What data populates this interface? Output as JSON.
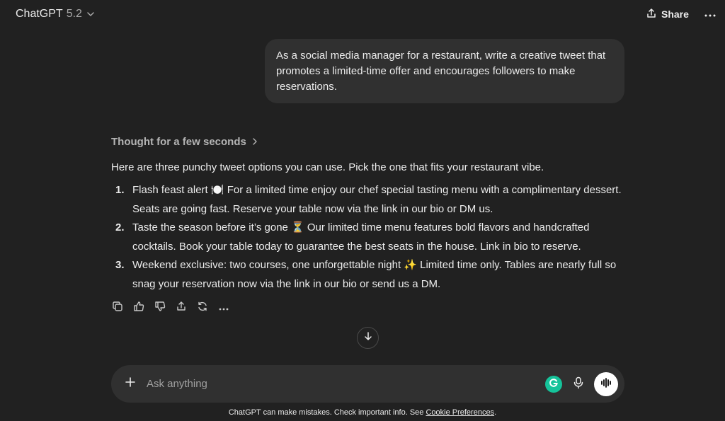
{
  "header": {
    "model_name": "ChatGPT",
    "model_version": "5.2",
    "share_label": "Share"
  },
  "conversation": {
    "user_message": "As a social media manager for a restaurant, write a creative tweet that promotes a limited-time offer and encourages followers to make reservations.",
    "thought_label": "Thought for a few seconds",
    "intro": "Here are three punchy tweet options you can use. Pick the one that fits your restaurant vibe.",
    "options": [
      {
        "number": "1.",
        "text": "Flash feast alert 🍽️ For a limited time enjoy our chef special tasting menu with a complimentary dessert. Seats are going fast. Reserve your table now via the link in our bio or DM us."
      },
      {
        "number": "2.",
        "text": "Taste the season before it’s gone ⏳ Our limited time menu features bold flavors and handcrafted cocktails. Book your table today to guarantee the best seats in the house. Link in bio to reserve."
      },
      {
        "number": "3.",
        "text": "Weekend exclusive: two courses, one unforgettable night ✨ Limited time only. Tables are nearly full so snag your reservation now via the link in our bio or send us a DM."
      }
    ]
  },
  "composer": {
    "placeholder": "Ask anything"
  },
  "footer": {
    "disclaimer": "ChatGPT can make mistakes. Check important info. See ",
    "link": "Cookie Preferences",
    "suffix": "."
  },
  "colors": {
    "background": "#212121",
    "bubble": "#303030",
    "grammarly": "#15c39a"
  }
}
